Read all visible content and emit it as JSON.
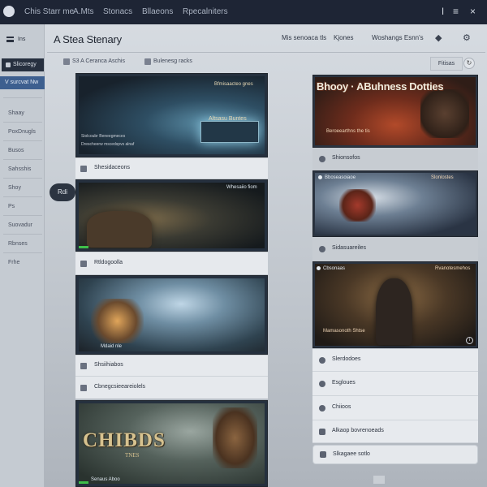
{
  "topbar": {
    "nav": [
      "Chis Starr me",
      "A.Mts",
      "Stonacs",
      "Bllaeons",
      "Rpecalniters"
    ],
    "icons": [
      "info-icon",
      "menu-icon",
      "close-icon"
    ]
  },
  "sidebar": {
    "header": "Ins",
    "items": [
      "Slicoregy",
      "V surcvat Nw",
      "Shaay",
      "PoxDnugls",
      "Busos",
      "Sahsshis",
      "Shoy",
      "Ps",
      "Suovadur",
      "Rbnses",
      "Frhe"
    ]
  },
  "bubble": "Rdi",
  "header": {
    "title": "A Stea Stenary",
    "links": [
      "Mis senoaca tls",
      "Kjones",
      "Woshangs Esnn's"
    ]
  },
  "filters": {
    "f1": "S3 A Ceranca Aschis",
    "f2": "Bulenesg racks",
    "button": "Fitisas"
  },
  "cards": [
    {
      "caption": "Bfmisaacteo gnes",
      "sign": "Altsasu Buntes",
      "sub": [
        "Siolcoubr Beneegmeces",
        "Drescheerw mscedspvs alnaf"
      ]
    },
    {
      "tag": "Whesaiio fiom"
    },
    {
      "tag": "Mdaid nle"
    },
    {
      "big_title": "CHIBDS",
      "big_sub": "TNES",
      "tag": "Senaus Aboo"
    }
  ],
  "rows": [
    "Shesidaceons",
    "Rtldogoolla",
    "Shsiihiabos",
    "Cbnegcsieeareiolels"
  ],
  "right_cards": [
    {
      "banner": "Bhooy · ABuhness Dotties",
      "caption": "Beroeearthns the tis"
    },
    {
      "tag": "Bboseasoiaoe",
      "caption": "Slonlostes"
    },
    {
      "tag": "Cbsonaas",
      "caption": "Rvanotesmehos",
      "sub": "Mamasonoth Shtse"
    }
  ],
  "right_rows": [
    "Shionsofos",
    "Sidasuareiles",
    "Slerdodoes",
    "Esgloues",
    "Chiioos",
    "Alkaop bovrenoeads",
    "Slkagaee sotlo"
  ]
}
